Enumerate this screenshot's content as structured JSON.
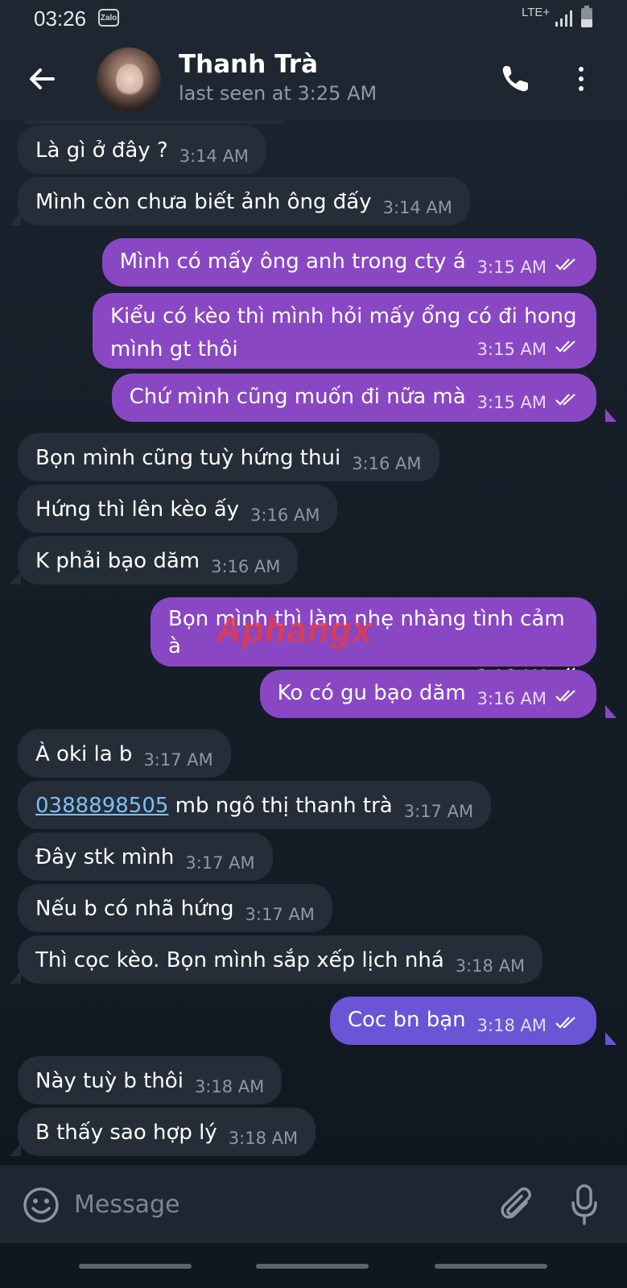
{
  "status_bar": {
    "time": "03:26",
    "app_badge": "Zalo",
    "network": "LTE+"
  },
  "header": {
    "contact_name": "Thanh Trà",
    "last_seen": "last seen at 3:25 AM"
  },
  "messages": [
    {
      "dir": "in",
      "text": "Là gì ở đây ?",
      "time": "3:14 AM"
    },
    {
      "dir": "in",
      "text": "Mình còn chưa biết ảnh ông đấy",
      "time": "3:14 AM"
    },
    {
      "dir": "out",
      "text": "Mình có mấy ông anh trong cty á",
      "time": "3:15 AM"
    },
    {
      "dir": "out",
      "text_line1": "Kiểu có kèo thì mình hỏi mấy ổng có đi hong",
      "text_line2": "mình gt thôi",
      "time": "3:15 AM"
    },
    {
      "dir": "out",
      "text": "Chứ mình cũng muốn đi nữa mà",
      "time": "3:15 AM"
    },
    {
      "dir": "in",
      "text": "Bọn mình cũng tuỳ hứng thui",
      "time": "3:16 AM"
    },
    {
      "dir": "in",
      "text": "Hứng thì lên kèo ấy",
      "time": "3:16 AM"
    },
    {
      "dir": "in",
      "text": "K phải bạo dăm",
      "time": "3:16 AM"
    },
    {
      "dir": "out",
      "text": "Bọn mình thì làm nhẹ nhàng tình cảm à",
      "time": "3:16 AM"
    },
    {
      "dir": "out",
      "text": "Ko có gu bạo dăm",
      "time": "3:16 AM"
    },
    {
      "dir": "in",
      "text": "À oki la b",
      "time": "3:17 AM"
    },
    {
      "dir": "in",
      "link": "0388898505",
      "text": " mb ngô thị thanh trà",
      "time": "3:17 AM"
    },
    {
      "dir": "in",
      "text": "Đây stk mình",
      "time": "3:17 AM"
    },
    {
      "dir": "in",
      "text": "Nếu b có nhã hứng",
      "time": "3:17 AM"
    },
    {
      "dir": "in",
      "text": "Thì cọc kèo. Bọn mình sắp xếp lịch nhá",
      "time": "3:18 AM"
    },
    {
      "dir": "out",
      "text": "Coc bn bạn",
      "time": "3:18 AM"
    },
    {
      "dir": "in",
      "text": "Này tuỳ b thôi",
      "time": "3:18 AM"
    },
    {
      "dir": "in",
      "text": "B thấy sao hợp lý",
      "time": "3:18 AM"
    }
  ],
  "watermark": "Aphangx",
  "input": {
    "placeholder": "Message"
  },
  "colors": {
    "incoming_bubble": "#242d38",
    "outgoing_bubble": "#8a47c4",
    "outgoing_bubble_latest": "#6a55d6",
    "header": "#1d2631",
    "link": "#7ec0f5"
  },
  "icons": {
    "back": "arrow-left-icon",
    "call": "phone-icon",
    "more": "more-vertical-icon",
    "emoji": "smiley-icon",
    "attach": "paperclip-icon",
    "mic": "microphone-icon",
    "read": "double-check-icon"
  }
}
